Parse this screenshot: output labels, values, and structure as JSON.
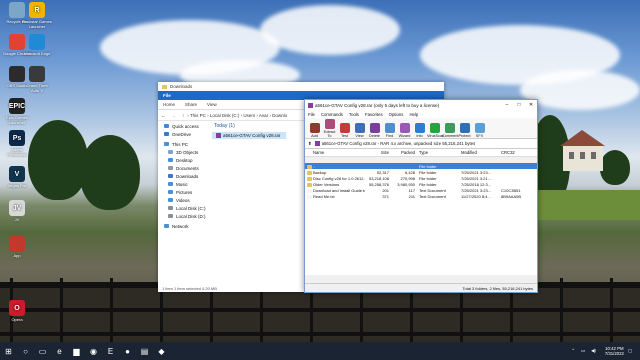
{
  "desktop_icons": [
    {
      "label": "Recycle Bin",
      "icon": "recycle-bin-icon",
      "color": "#7aa7c7"
    },
    {
      "label": "Rockstar Games Launcher",
      "icon": "rockstar-icon",
      "color": "#f1b400",
      "glyph": "R"
    },
    {
      "label": "Google Chrome",
      "icon": "chrome-icon",
      "color": "#e34133"
    },
    {
      "label": "Microsoft Edge",
      "icon": "edge-icon",
      "color": "#1f8bd7"
    },
    {
      "label": "OBS Studio",
      "icon": "obs-icon",
      "color": "#2b2b2b"
    },
    {
      "label": "Grand Theft Auto V",
      "icon": "gtav-icon",
      "color": "#3a3a3a"
    },
    {
      "label": "Epic Games Launcher",
      "icon": "epic-icon",
      "color": "#222",
      "glyph": "EPIC"
    },
    {
      "label": "Adobe Photoshop",
      "icon": "photoshop-icon",
      "color": "#0b2a4a",
      "glyph": "Ps"
    },
    {
      "label": "Vegas Pro",
      "icon": "vegas-icon",
      "color": "#11344e",
      "glyph": "V"
    },
    {
      "label": "JV",
      "icon": "jv-icon",
      "color": "#d8d8d8",
      "glyph": "JV"
    },
    {
      "label": "App",
      "icon": "red-app-icon",
      "color": "#c0392b"
    },
    {
      "label": "Opera",
      "icon": "opera-icon",
      "color": "#cc1b2a",
      "glyph": "O"
    }
  ],
  "explorer": {
    "title": "Downloads",
    "ribbon_tabs": [
      "File",
      "Home",
      "Share",
      "View"
    ],
    "breadcrumb": "›  This PC  ›  Local Disk (C:)  ›  Users  ›  Avar  ›  Downlo",
    "nav": [
      {
        "label": "Quick access",
        "color": "#3d8be0"
      },
      {
        "label": "OneDrive",
        "color": "#2b7cd3"
      },
      {
        "label": "This PC",
        "color": "#4a90d9"
      },
      {
        "label": "3D Objects",
        "color": "#7aa3d8"
      },
      {
        "label": "Desktop",
        "color": "#4a90d9"
      },
      {
        "label": "Documents",
        "color": "#8f9aa6"
      },
      {
        "label": "Downloads",
        "color": "#3b78c4"
      },
      {
        "label": "Music",
        "color": "#4a90d9"
      },
      {
        "label": "Pictures",
        "color": "#4a90d9"
      },
      {
        "label": "Videos",
        "color": "#4a90d9"
      },
      {
        "label": "Local Disk (C:)",
        "color": "#8a8f96"
      },
      {
        "label": "Local Disk (D:)",
        "color": "#8a8f96"
      },
      {
        "label": "Network",
        "color": "#4a90d9"
      }
    ],
    "group_header": "Today (1)",
    "files": [
      "a561ce-GTAV Config v28.rar"
    ],
    "status": "1 item     1 item selected  4.20 MB"
  },
  "rar": {
    "title": "a561ce-GTAV Config v28.rar (only 5 days left to buy a license)",
    "menu": [
      "File",
      "Commands",
      "Tools",
      "Favorites",
      "Options",
      "Help"
    ],
    "toolbar": [
      {
        "label": "Add",
        "icon": "add-icon",
        "color": "#8d3b2e"
      },
      {
        "label": "Extract To",
        "icon": "extract-to-icon",
        "color": "#b04a7a"
      },
      {
        "label": "Test",
        "icon": "test-icon",
        "color": "#c23b3b"
      },
      {
        "label": "View",
        "icon": "view-icon",
        "color": "#3c6fb8"
      },
      {
        "label": "Delete",
        "icon": "delete-icon",
        "color": "#7a3e9e"
      },
      {
        "label": "Find",
        "icon": "find-icon",
        "color": "#4f8ed1"
      },
      {
        "label": "Wizard",
        "icon": "wizard-icon",
        "color": "#9b59b6"
      },
      {
        "label": "Info",
        "icon": "info-icon",
        "color": "#2f7dd1"
      },
      {
        "label": "VirusScan",
        "icon": "virusscan-icon",
        "color": "#27a342"
      },
      {
        "label": "Comment",
        "icon": "comment-icon",
        "color": "#3c9a5d"
      },
      {
        "label": "Protect",
        "icon": "protect-icon",
        "color": "#2e6fb5"
      },
      {
        "label": "SFX",
        "icon": "sfx-icon",
        "color": "#5aa0d8"
      }
    ],
    "path": "a561ce-GTAV Config v28.rar - RAR 4.x archive, unpacked size 55,216,241 bytes",
    "columns": [
      "Name",
      "Size",
      "Packed",
      "Type",
      "Modified",
      "CRC32"
    ],
    "rows": [
      {
        "name": "..",
        "size": "",
        "packed": "",
        "type": "File folder",
        "modified": "",
        "crc": "",
        "selected": true,
        "color": "#e8c25a"
      },
      {
        "name": "Backup",
        "size": "92,317",
        "packed": "6,428",
        "type": "File folder",
        "modified": "7/25/2021 3:23...",
        "crc": "",
        "color": "#e8c25a"
      },
      {
        "name": "Disc Config v28 for 1.0.2612.1",
        "size": "53,218,108",
        "packed": "270,998",
        "type": "File folder",
        "modified": "7/25/2021 3:21...",
        "crc": "",
        "color": "#e8c25a"
      },
      {
        "name": "Older Versions",
        "size": "55,258,376",
        "packed": "3,980,930",
        "type": "File folder",
        "modified": "7/25/2018 12:3...",
        "crc": "",
        "color": "#e8c25a"
      },
      {
        "name": "Download and Install Guide.txt",
        "size": "201",
        "packed": "117",
        "type": "Text Document",
        "modified": "7/25/2021 3:23...",
        "crc": "C10C3B51",
        "color": "#f5f5f5"
      },
      {
        "name": "Read Me.txt",
        "size": "371",
        "packed": "211",
        "type": "Text Document",
        "modified": "11/27/2020 8:4...",
        "crc": "8B9AAA0B",
        "color": "#f5f5f5"
      }
    ],
    "status_left": "",
    "status_right": "Total 3 folders, 2 files, 55,216,241 bytes"
  },
  "taskbar": {
    "pinned": [
      {
        "icon": "windows-start-icon",
        "glyph": "⊞"
      },
      {
        "icon": "search-icon",
        "glyph": "○"
      },
      {
        "icon": "task-view-icon",
        "glyph": "▭"
      },
      {
        "icon": "edge-icon",
        "glyph": "e"
      },
      {
        "icon": "file-explorer-icon",
        "glyph": "▆"
      },
      {
        "icon": "chrome-icon",
        "glyph": "◉"
      },
      {
        "icon": "epic-icon",
        "glyph": "E"
      },
      {
        "icon": "obs-icon",
        "glyph": "●"
      },
      {
        "icon": "winrar-icon",
        "glyph": "▤"
      },
      {
        "icon": "app-icon",
        "glyph": "◆"
      }
    ],
    "time": "10:42 PM",
    "date": "7/31/2022"
  }
}
